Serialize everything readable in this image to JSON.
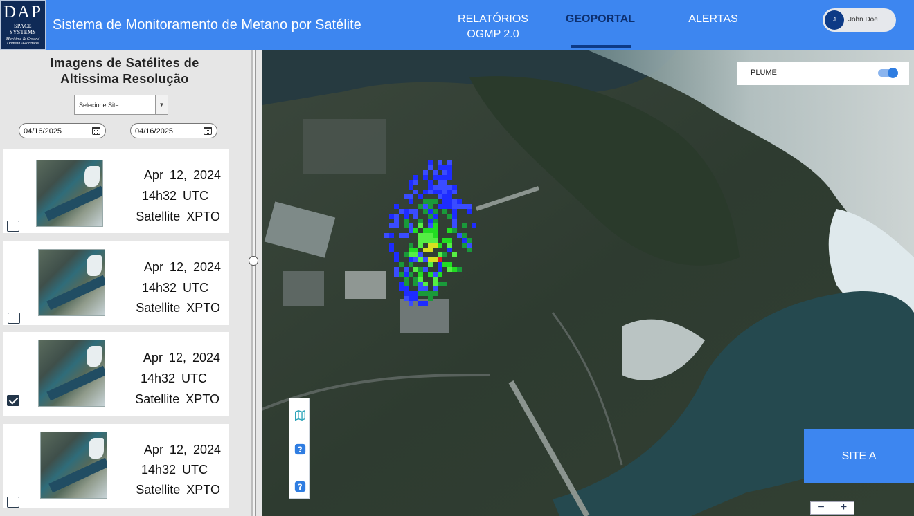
{
  "header": {
    "logo_text": "DAP",
    "logo_subtitle": "SPACE SYSTEMS",
    "logo_tagline_1": "Maritime & Ground",
    "logo_tagline_2": "Domain Awareness",
    "app_title": "Sistema de Monitoramento de Metano por Satélite",
    "nav": [
      {
        "label": "RELATÓRIOS OGMP 2.0",
        "active": false
      },
      {
        "label": "GEOPORTAL",
        "active": true
      },
      {
        "label": "ALERTAS",
        "active": false
      }
    ],
    "user": {
      "initial": "J",
      "name": "John Doe"
    },
    "colors": {
      "bar": "#3d86f0",
      "active_nav": "#0d2f6e"
    }
  },
  "sidebar": {
    "title": "Imagens de Satélites de Altissima Resolução",
    "site_select": {
      "value": "Selecione Site"
    },
    "date_from": "04/16/2025",
    "date_to": "04/16/2025",
    "items": [
      {
        "date": "Apr  12,  2024",
        "time": "14h32  UTC",
        "satellite": "Satellite  XPTO",
        "checked": false
      },
      {
        "date": "Apr  12,  2024",
        "time": "14h32  UTC",
        "satellite": "Satellite  XPTO",
        "checked": false
      },
      {
        "date": "Apr  12,  2024",
        "time": "14h32  UTC",
        "satellite": "Satellite  XPTO",
        "checked": true
      },
      {
        "date": "Apr  12,  2024",
        "time": "14h32  UTC",
        "satellite": "Satellite  XPTO",
        "checked": false
      }
    ]
  },
  "map": {
    "plume_label": "PLUME",
    "plume_enabled": true,
    "site_label": "SITE A",
    "zoom_out": "−",
    "zoom_in": "+",
    "tools": [
      "map-icon",
      "help-icon",
      "help-icon"
    ],
    "colors": {
      "toggle": "#2f7de1",
      "site_card": "#3d86f0"
    }
  }
}
